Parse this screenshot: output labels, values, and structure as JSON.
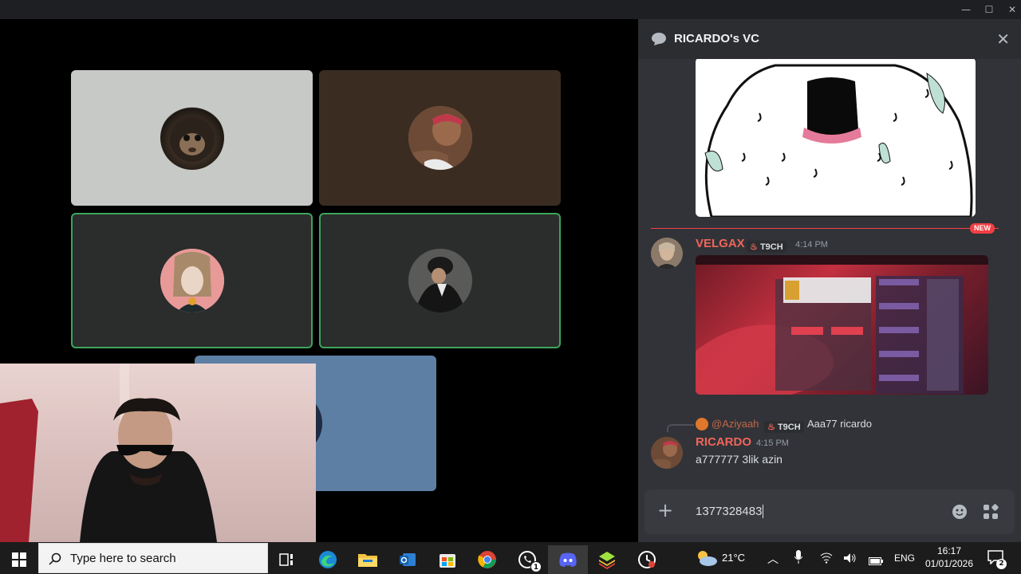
{
  "window": {
    "minimize_glyph": "—",
    "maximize_glyph": "☐",
    "close_glyph": "✕"
  },
  "voice_channel": {
    "participants": [
      {
        "avatar": "monkey-avatar",
        "bg": "#c6c9c6",
        "speaking": false
      },
      {
        "avatar": "shirtless-man-avatar",
        "bg": "#3b2c22",
        "speaking": false
      },
      {
        "avatar": "anime-character-avatar",
        "bg": "#2b2d2c",
        "speaking": true
      },
      {
        "avatar": "hooded-person-avatar",
        "bg": "#2b2d2c",
        "speaking": true
      },
      {
        "avatar": "robot-avatar",
        "bg": "#5d7fa4",
        "speaking": false
      }
    ]
  },
  "chat": {
    "title": "RICARDO's VC",
    "new_badge": "NEW",
    "messages": [
      {
        "author": "VELGAX",
        "author_color": "#f0655a",
        "tag": "T9CH",
        "time": "4:14 PM"
      },
      {
        "reply_to": "@Aziyaah",
        "reply_tag": "T9CH",
        "reply_text": "Aaa77 ricardo",
        "author": "RICARDO",
        "author_color": "#f0655a",
        "time": "4:15 PM",
        "text": "a777777 3lik azin"
      }
    ],
    "composer_value": "1377328483"
  },
  "taskbar": {
    "search_placeholder": "Type here to search",
    "weather_temp": "21°C",
    "language": "ENG",
    "clock_time": "16:17",
    "clock_date": "01/01/2026",
    "whatsapp_badge": "1",
    "notification_count": "2"
  }
}
